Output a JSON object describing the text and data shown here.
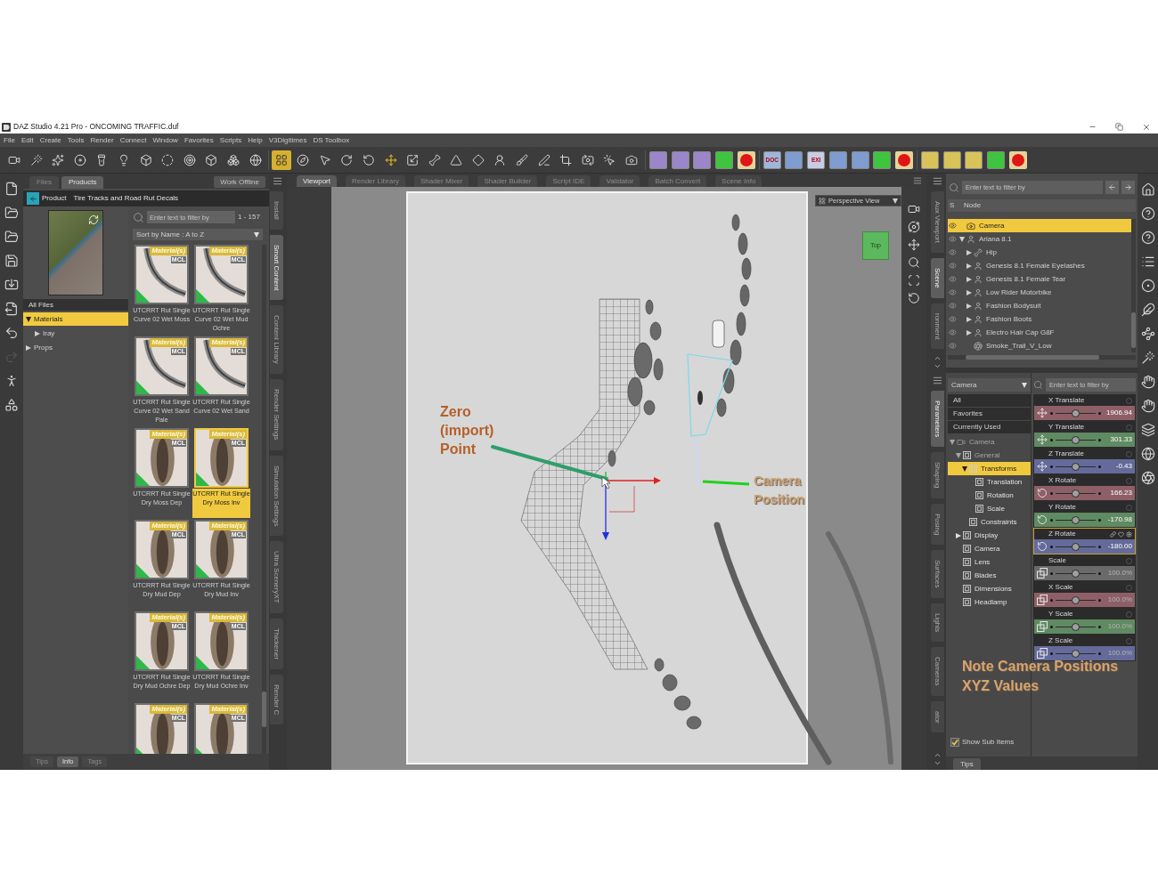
{
  "window": {
    "title": "DAZ Studio 4.21 Pro - ONCOMING TRAFFIC.duf"
  },
  "menu": [
    "File",
    "Edit",
    "Create",
    "Tools",
    "Render",
    "Connect",
    "Window",
    "Favorites",
    "Scripts",
    "Help",
    "V3Digitimes",
    "DS Toolbox"
  ],
  "toolbar": {
    "create_tools": [
      {
        "selected": false
      },
      {
        "selected": false
      },
      {
        "selected": false
      },
      {
        "selected": false
      },
      {
        "selected": false
      },
      {
        "selected": false
      },
      {
        "selected": false
      },
      {
        "selected": false
      },
      {
        "selected": false
      },
      {
        "selected": false
      },
      {
        "selected": false
      },
      {
        "selected": false
      }
    ],
    "edit_tools": [
      {
        "selected": true
      },
      {
        "selected": false
      },
      {
        "selected": false
      },
      {
        "selected": false
      },
      {
        "selected": false
      },
      {
        "selected": false
      },
      {
        "selected": false
      },
      {
        "selected": false
      },
      {
        "selected": false
      },
      {
        "selected": false
      },
      {
        "selected": false
      },
      {
        "selected": false
      },
      {
        "selected": false
      },
      {
        "selected": false
      },
      {
        "selected": false
      },
      {
        "selected": false
      },
      {
        "selected": false
      }
    ],
    "script_groups": [
      [
        {
          "kind": "tile",
          "color": "#9a86c8"
        },
        {
          "kind": "tile",
          "color": "#9a86c8"
        },
        {
          "kind": "tile",
          "color": "#9a86c8"
        },
        {
          "kind": "tile",
          "color": "#3ec43e"
        },
        {
          "kind": "dot",
          "color": "#e01515"
        }
      ],
      [
        {
          "kind": "tile",
          "color": "#9fb6dc",
          "label": "DOC"
        },
        {
          "kind": "tile",
          "color": "#7e9ccf"
        },
        {
          "kind": "tile",
          "color": "#c8cce6",
          "label": "EXI"
        },
        {
          "kind": "tile",
          "color": "#7e9ccf"
        },
        {
          "kind": "tile",
          "color": "#7e9ccf"
        },
        {
          "kind": "tile",
          "color": "#3ec43e"
        },
        {
          "kind": "dot",
          "color": "#e01515"
        }
      ],
      [
        {
          "kind": "tile",
          "color": "#d8c25a"
        },
        {
          "kind": "tile",
          "color": "#d8c25a"
        },
        {
          "kind": "tile",
          "color": "#d8c25a"
        },
        {
          "kind": "tile",
          "color": "#3ec43e"
        },
        {
          "kind": "dot",
          "color": "#e01515"
        }
      ]
    ]
  },
  "file_tools": [
    {
      "disabled": false
    },
    {
      "disabled": false
    },
    {
      "disabled": false
    },
    {
      "disabled": false
    },
    {
      "disabled": false
    },
    {
      "disabled": false
    },
    {
      "disabled": false
    },
    {
      "disabled": true
    },
    {
      "disabled": false
    },
    {
      "disabled": false
    }
  ],
  "content_panel": {
    "tabs": [
      {
        "label": "Files",
        "selected": false
      },
      {
        "label": "Products",
        "selected": true
      }
    ],
    "work_offline": "Work Offline",
    "breadcrumb": {
      "prefix": "Product",
      "title": "Tire Tracks and Road Rut Decals"
    },
    "tree_header": "All Files",
    "categories": [
      {
        "label": "Materials",
        "selected": true,
        "expanded": true,
        "children": [
          {
            "label": "Iray",
            "selected": false,
            "expanded": false
          }
        ]
      },
      {
        "label": "Props",
        "selected": false,
        "expanded": false
      }
    ],
    "search": {
      "placeholder": "Enter text to filter by"
    },
    "count": "1 - 157",
    "sort": "Sort by Name : A to Z",
    "items": [
      {
        "label": "UTCRRT Rut Single Curve 02 Wet Moss",
        "badge": "Material(s)",
        "tag": "MCL",
        "kind": "curve",
        "selected": false
      },
      {
        "label": "UTCRRT Rut Single Curve 02 Wet Mud Ochre",
        "badge": "Material(s)",
        "tag": "MCL",
        "kind": "curve",
        "selected": false
      },
      {
        "label": "UTCRRT Rut Single Curve 02 Wet Sand Pale",
        "badge": "Material(s)",
        "tag": "MCL",
        "kind": "curve",
        "selected": false
      },
      {
        "label": "UTCRRT Rut Single Curve 02 Wet Sand",
        "badge": "Material(s)",
        "tag": "MCL",
        "kind": "curve",
        "selected": false
      },
      {
        "label": "UTCRRT Rut Single Dry Moss Dep",
        "badge": "Material(s)",
        "tag": "MCL",
        "kind": "stain",
        "selected": false
      },
      {
        "label": "UTCRRT Rut Single Dry Moss Inv",
        "badge": "Material(s)",
        "tag": "MCL",
        "kind": "stain",
        "selected": true
      },
      {
        "label": "UTCRRT Rut Single Dry Mud Dep",
        "badge": "Material(s)",
        "tag": "MCL",
        "kind": "stain",
        "selected": false
      },
      {
        "label": "UTCRRT Rut Single Dry Mud Inv",
        "badge": "Material(s)",
        "tag": "MCL",
        "kind": "stain",
        "selected": false
      },
      {
        "label": "UTCRRT Rut Single Dry Mud Ochre Dep",
        "badge": "Material(s)",
        "tag": "MCL",
        "kind": "stain",
        "selected": false
      },
      {
        "label": "UTCRRT Rut Single Dry Mud Ochre Inv",
        "badge": "Material(s)",
        "tag": "MCL",
        "kind": "stain",
        "selected": false
      },
      {
        "badge": "Material(s)",
        "tag": "MCL",
        "kind": "stain",
        "selected": false
      },
      {
        "badge": "Material(s)",
        "tag": "MCL",
        "kind": "stain",
        "selected": false
      }
    ],
    "bottom_tabs": [
      {
        "label": "Tips",
        "selected": false
      },
      {
        "label": "Info",
        "selected": true
      },
      {
        "label": "Tags",
        "selected": false
      }
    ]
  },
  "content_side_tabs": [
    {
      "label": "Install",
      "selected": false
    },
    {
      "label": "Smart Content",
      "selected": true
    },
    {
      "label": "Content Library",
      "selected": false
    },
    {
      "label": "Render Settings",
      "selected": false
    },
    {
      "label": "Simulation Settings",
      "selected": false
    },
    {
      "label": "Ultra SceneryXT",
      "selected": false
    },
    {
      "label": "Thickener",
      "selected": false
    },
    {
      "label": "Render C",
      "selected": false
    }
  ],
  "viewport": {
    "tabs": [
      {
        "label": "Viewport",
        "selected": true
      },
      {
        "label": "Render Library",
        "selected": false
      },
      {
        "label": "Shader Mixer",
        "selected": false
      },
      {
        "label": "Shader Builder",
        "selected": false
      },
      {
        "label": "Script IDE",
        "selected": false
      },
      {
        "label": "Validator",
        "selected": false
      },
      {
        "label": "Batch Convert",
        "selected": false
      },
      {
        "label": "Scene Info",
        "selected": false
      }
    ],
    "view_menu": "Perspective View",
    "view_cube": "Top",
    "annotations": [
      {
        "kind": "origin",
        "text": "Zero (import) Point"
      },
      {
        "kind": "camera",
        "text": "Camera Position"
      }
    ]
  },
  "scene_side_tabs": [
    {
      "label": "Aux Viewport",
      "selected": false
    },
    {
      "label": "Scene",
      "selected": true
    },
    {
      "label": "ronment",
      "selected": false
    }
  ],
  "scene": {
    "search": {
      "placeholder": "Enter text to filter by"
    },
    "columns": [
      "S",
      "Node"
    ],
    "nodes": [
      {
        "label": "Camera",
        "kind": "camera",
        "selected": true
      },
      {
        "label": "Ariana 8.1",
        "kind": "figure",
        "expanded": true,
        "selected": false,
        "children": [
          {
            "label": "Hip",
            "kind": "bone",
            "expanded": false,
            "selected": false
          },
          {
            "label": "Genesis 8.1 Female Eyelashes",
            "kind": "figure",
            "expanded": false,
            "selected": false
          },
          {
            "label": "Genesis 8.1 Female Tear",
            "kind": "figure",
            "expanded": false,
            "selected": false
          },
          {
            "label": "Low Rider Motorbike",
            "kind": "figure",
            "expanded": false,
            "selected": false
          },
          {
            "label": "Fashion Bodysuit",
            "kind": "figure",
            "expanded": false,
            "selected": false
          },
          {
            "label": "Fashion Boots",
            "kind": "figure",
            "expanded": false,
            "selected": false
          },
          {
            "label": "Electro Hair Cap G8F",
            "kind": "figure",
            "expanded": false,
            "selected": false
          },
          {
            "label": "Smoke_Trail_V_Low",
            "kind": "prop",
            "selected": false
          }
        ]
      }
    ]
  },
  "parameter_side_tabs": [
    {
      "label": "Parameters",
      "selected": true
    },
    {
      "label": "Shaping",
      "selected": false
    },
    {
      "label": "Posing",
      "selected": false
    },
    {
      "label": "Surfaces",
      "selected": false
    },
    {
      "label": "Lights",
      "selected": false
    },
    {
      "label": "Cameras",
      "selected": false
    },
    {
      "label": "ator",
      "selected": false
    }
  ],
  "parameters": {
    "node_menu": "Camera",
    "filters": [
      {
        "label": "All",
        "selected": false
      },
      {
        "label": "Favorites",
        "selected": false
      },
      {
        "label": "Currently Used",
        "selected": false
      }
    ],
    "groups": [
      {
        "label": "Camera",
        "kind": "node",
        "expanded": true,
        "selected": false,
        "dimmed": true,
        "children": [
          {
            "label": "General",
            "kind": "group",
            "expanded": true,
            "selected": false,
            "dimmed": true,
            "children": [
              {
                "label": "Transforms",
                "kind": "group",
                "expanded": true,
                "selected": true,
                "dimmed": false,
                "children": [
                  {
                    "label": "Translation",
                    "kind": "group",
                    "selected": false,
                    "dimmed": false
                  },
                  {
                    "label": "Rotation",
                    "kind": "group",
                    "selected": false,
                    "dimmed": false
                  },
                  {
                    "label": "Scale",
                    "kind": "group",
                    "selected": false,
                    "dimmed": false
                  }
                ]
              },
              {
                "label": "Constraints",
                "kind": "group",
                "selected": false,
                "dimmed": false
              }
            ]
          },
          {
            "label": "Display",
            "kind": "group",
            "expanded": false,
            "selected": false,
            "dimmed": false
          },
          {
            "label": "Camera",
            "kind": "group",
            "selected": false,
            "dimmed": false
          },
          {
            "label": "Lens",
            "kind": "group",
            "selected": false,
            "dimmed": false
          },
          {
            "label": "Blades",
            "kind": "group",
            "selected": false,
            "dimmed": false
          },
          {
            "label": "Dimensions",
            "kind": "group",
            "selected": false,
            "dimmed": false
          },
          {
            "label": "Headlamp",
            "kind": "group",
            "selected": false,
            "dimmed": false
          }
        ]
      }
    ],
    "show_sub_items": {
      "label": "Show Sub Items",
      "checked": true
    },
    "search": {
      "placeholder": "Enter text to filter by"
    },
    "properties": [
      {
        "label": "X Translate",
        "value": "1906.94",
        "kind": "translate",
        "color": "#8e5f66",
        "level": 0.5,
        "selected": false,
        "disabled": false
      },
      {
        "label": "Y Translate",
        "value": "301.33",
        "kind": "translate",
        "color": "#5f8a62",
        "level": 0.5,
        "selected": false,
        "disabled": false
      },
      {
        "label": "Z Translate",
        "value": "-0.43",
        "kind": "translate",
        "color": "#646a9a",
        "level": 0.5,
        "selected": false,
        "disabled": false
      },
      {
        "label": "X Rotate",
        "value": "166.23",
        "kind": "rotate",
        "color": "#8e5f66",
        "level": 0.5,
        "selected": false,
        "disabled": false
      },
      {
        "label": "Y Rotate",
        "value": "-170.98",
        "kind": "rotate",
        "color": "#5f8a62",
        "level": 0.5,
        "selected": false,
        "disabled": false
      },
      {
        "label": "Z Rotate",
        "value": "-180.00",
        "kind": "rotate",
        "color": "#646a9a",
        "level": 0.5,
        "selected": true,
        "disabled": false
      },
      {
        "label": "Scale",
        "value": "100.0%",
        "kind": "scale",
        "color": "#6a6a6a",
        "level": 0.5,
        "selected": false,
        "disabled": true
      },
      {
        "label": "X Scale",
        "value": "100.0%",
        "kind": "scale",
        "color": "#8e5f66",
        "level": 0.5,
        "selected": false,
        "disabled": true
      },
      {
        "label": "Y Scale",
        "value": "100.0%",
        "kind": "scale",
        "color": "#5f8a62",
        "level": 0.5,
        "selected": false,
        "disabled": true
      },
      {
        "label": "Z Scale",
        "value": "100.0%",
        "kind": "scale",
        "color": "#646a9a",
        "level": 0.5,
        "selected": false,
        "disabled": true
      }
    ]
  },
  "note": "Note Camera Positions XYZ Values",
  "tips_tab": "Tips"
}
